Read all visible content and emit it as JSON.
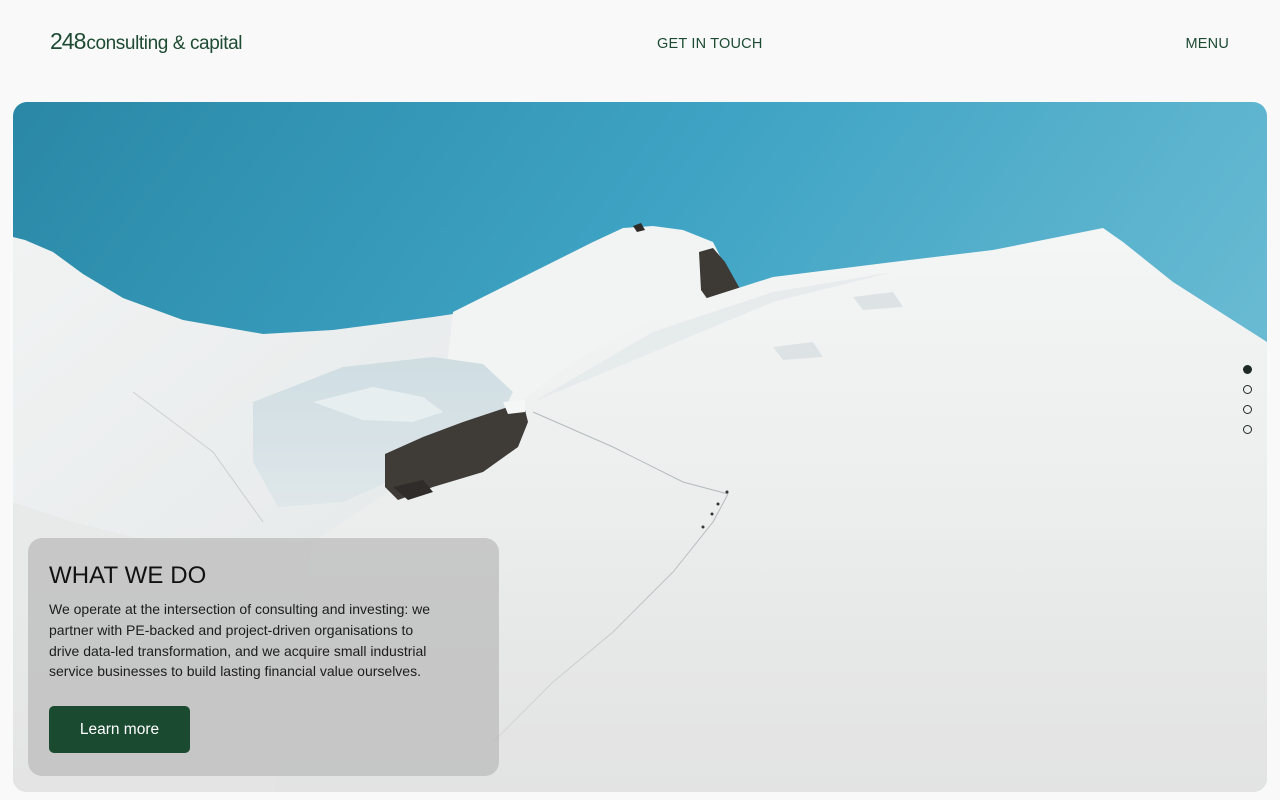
{
  "header": {
    "logo_number": "248",
    "logo_text": "consulting & capital",
    "get_in_touch": "GET IN TOUCH",
    "menu": "MENU"
  },
  "slider": {
    "slide_count": 4,
    "active_index": 0
  },
  "card": {
    "title": "WHAT WE DO",
    "body": "We operate at the intersection of consulting and investing: we partner with PE-backed and project-driven organisations to drive data-led transformation, and we acquire small industrial service businesses to build lasting financial value ourselves.",
    "button_label": "Learn more"
  },
  "colors": {
    "brand_green": "#1e4a33",
    "button_green": "#1a4a30",
    "page_background": "#f8f9f8"
  }
}
